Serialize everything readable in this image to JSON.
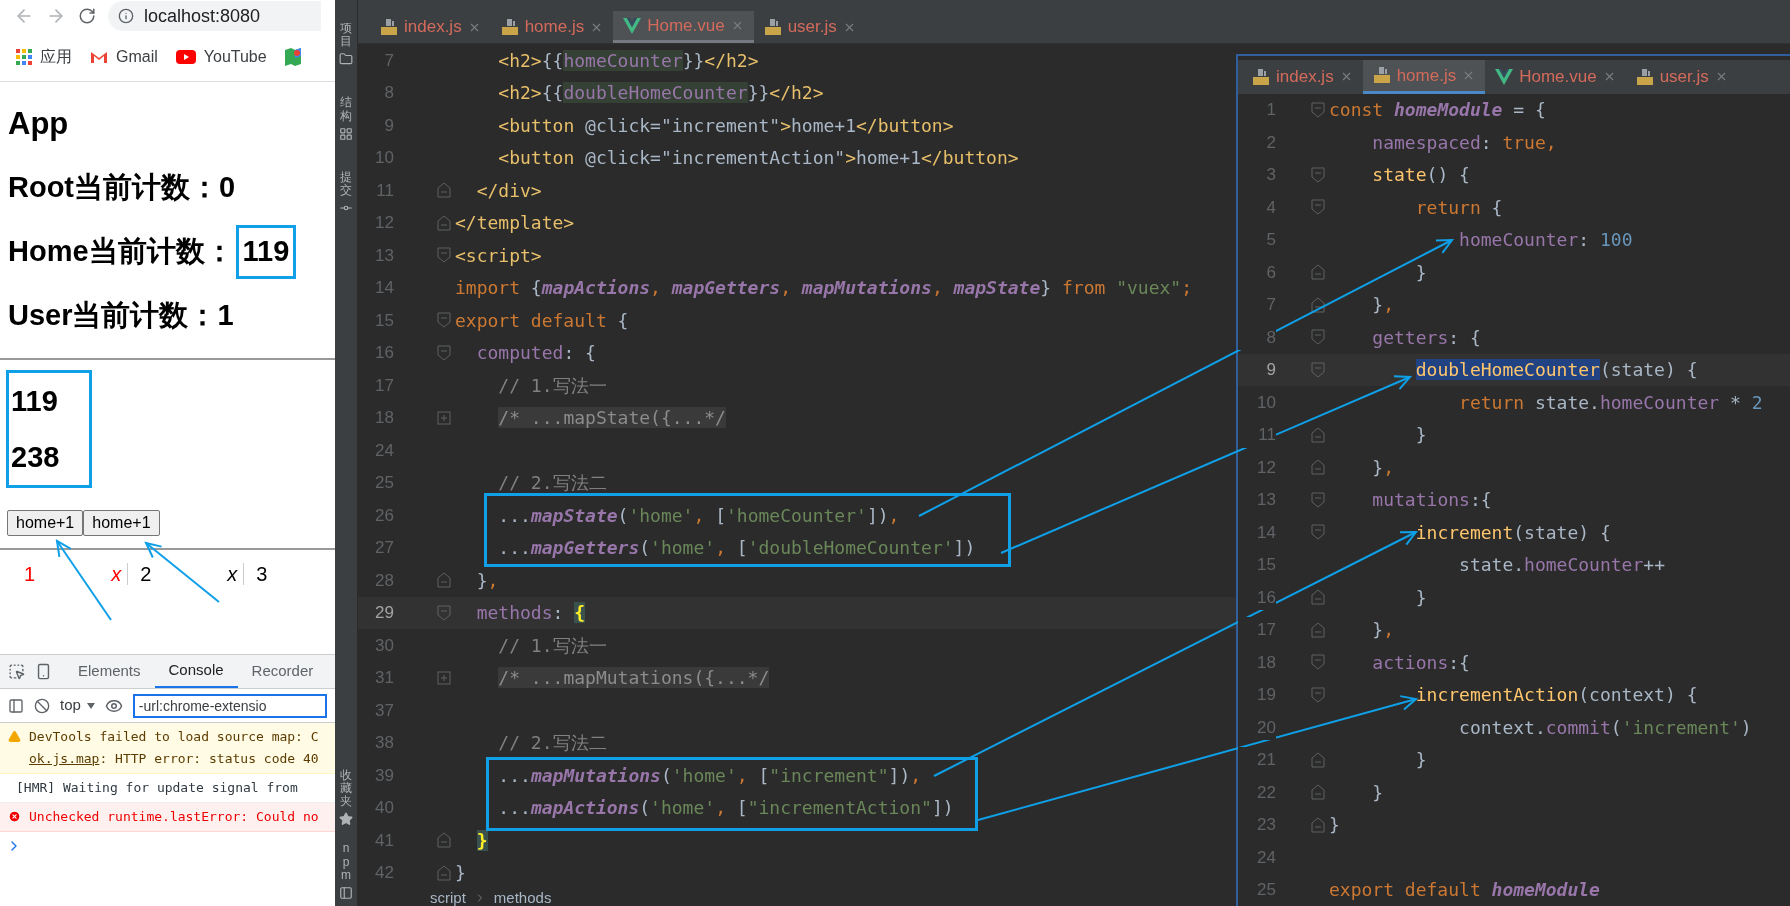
{
  "browser": {
    "url": "localhost:8080",
    "bookmarks": [
      {
        "kind": "apps",
        "label": "应用"
      },
      {
        "kind": "gmail",
        "label": "Gmail"
      },
      {
        "kind": "youtube",
        "label": "YouTube"
      },
      {
        "kind": "maps"
      }
    ],
    "page": {
      "title": "App",
      "counters": [
        {
          "label": "Root当前计数：",
          "value": "0",
          "highlighted": false
        },
        {
          "label": "Home当前计数：",
          "value": "119",
          "highlighted": true
        },
        {
          "label": "User当前计数：",
          "value": "1",
          "highlighted": false
        }
      ],
      "values": [
        "119",
        "238"
      ],
      "buttons": [
        "home+1",
        "home+1"
      ],
      "results": [
        {
          "text": "1",
          "invalid": true,
          "italic": false,
          "divider": false
        },
        {
          "text": "x",
          "invalid": true,
          "italic": true,
          "divider": true
        },
        {
          "text": "2",
          "invalid": false,
          "italic": false,
          "divider": false
        },
        {
          "text": "x",
          "invalid": false,
          "italic": true,
          "divider": true
        },
        {
          "text": "3",
          "invalid": false,
          "italic": false,
          "divider": false
        }
      ]
    },
    "devtools": {
      "tabs": [
        {
          "label": "Elements",
          "selected": false
        },
        {
          "label": "Console",
          "selected": true
        },
        {
          "label": "Recorder",
          "selected": false
        }
      ],
      "context": "top",
      "filter": "-url:chrome-extensio",
      "messages": [
        {
          "kind": "warning",
          "text": "DevTools failed to load source map: C",
          "link": "ok.js.map",
          "detail": ": HTTP error: status code 40"
        },
        {
          "kind": "info",
          "text": "[HMR] Waiting for update signal from"
        },
        {
          "kind": "error",
          "text": "Unchecked runtime.lastError: Could no"
        }
      ]
    }
  },
  "tool_strip": {
    "top": [
      {
        "kind": "project",
        "label": "项目"
      },
      {
        "kind": "structure",
        "label": "结构"
      },
      {
        "kind": "commit",
        "label": "提交"
      }
    ],
    "bottom": [
      {
        "kind": "favorites",
        "label": "收藏夹"
      },
      {
        "kind": "npm",
        "label": "npm"
      }
    ]
  },
  "editor": {
    "tabs": [
      {
        "label": "index.js",
        "kind": "js",
        "selected": false
      },
      {
        "label": "home.js",
        "kind": "js",
        "selected": false
      },
      {
        "label": "Home.vue",
        "kind": "vue",
        "selected": true
      },
      {
        "label": "user.js",
        "kind": "js",
        "selected": false
      }
    ],
    "lines": [
      {
        "number": "7",
        "current": false,
        "tokens": [
          {
            "text": "    <h2>",
            "kind": "tag"
          },
          {
            "text": "{{",
            "kind": "plain"
          },
          {
            "text": "homeCounter",
            "kind": "usage"
          },
          {
            "text": "}}",
            "kind": "plain"
          },
          {
            "text": "</h2>",
            "kind": "tag"
          }
        ]
      },
      {
        "number": "8",
        "current": false,
        "tokens": [
          {
            "text": "    <h2>",
            "kind": "tag"
          },
          {
            "text": "{{",
            "kind": "plain"
          },
          {
            "text": "doubleHomeCounter",
            "kind": "usage"
          },
          {
            "text": "}}",
            "kind": "plain"
          },
          {
            "text": "</h2>",
            "kind": "tag"
          }
        ]
      },
      {
        "number": "9",
        "current": false,
        "tokens": [
          {
            "text": "    <button ",
            "kind": "tag"
          },
          {
            "text": "@click=\"increment\"",
            "kind": "plain"
          },
          {
            "text": ">",
            "kind": "tag"
          },
          {
            "text": "home+1",
            "kind": "plain"
          },
          {
            "text": "</button>",
            "kind": "tag"
          }
        ]
      },
      {
        "number": "10",
        "current": false,
        "tokens": [
          {
            "text": "    <button ",
            "kind": "tag"
          },
          {
            "text": "@click=\"incrementAction\"",
            "kind": "plain"
          },
          {
            "text": ">",
            "kind": "tag"
          },
          {
            "text": "home+1",
            "kind": "plain"
          },
          {
            "text": "</button>",
            "kind": "tag"
          }
        ]
      },
      {
        "number": "11",
        "current": false,
        "kind": "close",
        "tokens": [
          {
            "text": "  </div>",
            "kind": "tag"
          }
        ]
      },
      {
        "number": "12",
        "current": false,
        "kind": "close",
        "tokens": [
          {
            "text": "</template>",
            "kind": "tag"
          }
        ]
      },
      {
        "number": "13",
        "current": false,
        "kind": "open",
        "tokens": [
          {
            "text": "<script>",
            "kind": "tag"
          }
        ]
      },
      {
        "number": "14",
        "current": false,
        "tokens": [
          {
            "text": "import ",
            "kind": "keyword"
          },
          {
            "text": "{",
            "kind": "plain"
          },
          {
            "text": "mapActions",
            "kind": "func"
          },
          {
            "text": ", ",
            "kind": "keyword"
          },
          {
            "text": "mapGetters",
            "kind": "func"
          },
          {
            "text": ", ",
            "kind": "keyword"
          },
          {
            "text": "mapMutations",
            "kind": "func"
          },
          {
            "text": ", ",
            "kind": "keyword"
          },
          {
            "text": "mapState",
            "kind": "func"
          },
          {
            "text": "} ",
            "kind": "plain"
          },
          {
            "text": "from ",
            "kind": "keyword"
          },
          {
            "text": "\"vuex\"",
            "kind": "string"
          },
          {
            "text": ";",
            "kind": "keyword"
          }
        ]
      },
      {
        "number": "15",
        "current": false,
        "kind": "open",
        "tokens": [
          {
            "text": "export default ",
            "kind": "keyword"
          },
          {
            "text": "{",
            "kind": "plain"
          }
        ]
      },
      {
        "number": "16",
        "current": false,
        "kind": "open",
        "tokens": [
          {
            "text": "  computed",
            "kind": "prop"
          },
          {
            "text": ": {",
            "kind": "plain"
          }
        ]
      },
      {
        "number": "17",
        "current": false,
        "tokens": [
          {
            "text": "    // 1.写法一",
            "kind": "comment"
          }
        ]
      },
      {
        "number": "18",
        "current": false,
        "kind": "collapsed",
        "tokens": [
          {
            "text": "    /* ...mapState({...*/",
            "kind": "folded"
          }
        ]
      },
      {
        "number": "24",
        "current": false
      },
      {
        "number": "25",
        "current": false,
        "tokens": [
          {
            "text": "    // 2.写法二",
            "kind": "comment"
          }
        ]
      },
      {
        "number": "26",
        "current": false,
        "tokens": [
          {
            "text": "    ...",
            "kind": "plain"
          },
          {
            "text": "mapState",
            "kind": "func"
          },
          {
            "text": "(",
            "kind": "plain"
          },
          {
            "text": "'home'",
            "kind": "string"
          },
          {
            "text": ", ",
            "kind": "keyword"
          },
          {
            "text": "[",
            "kind": "plain"
          },
          {
            "text": "'homeCounter'",
            "kind": "string"
          },
          {
            "text": "])",
            "kind": "plain"
          },
          {
            "text": ",",
            "kind": "keyword"
          }
        ]
      },
      {
        "number": "27",
        "current": false,
        "tokens": [
          {
            "text": "    ...",
            "kind": "plain"
          },
          {
            "text": "mapGetters",
            "kind": "func"
          },
          {
            "text": "(",
            "kind": "plain"
          },
          {
            "text": "'home'",
            "kind": "string"
          },
          {
            "text": ", ",
            "kind": "keyword"
          },
          {
            "text": "[",
            "kind": "plain"
          },
          {
            "text": "'doubleHomeCounter'",
            "kind": "string"
          },
          {
            "text": "])",
            "kind": "plain"
          }
        ]
      },
      {
        "number": "28",
        "current": false,
        "kind": "close",
        "tokens": [
          {
            "text": "  }",
            "kind": "plain"
          },
          {
            "text": ",",
            "kind": "keyword"
          }
        ]
      },
      {
        "number": "29",
        "current": true,
        "kind": "open",
        "tokens": [
          {
            "text": "  methods",
            "kind": "prop"
          },
          {
            "text": ": ",
            "kind": "plain"
          },
          {
            "text": "{",
            "kind": "brace"
          }
        ]
      },
      {
        "number": "30",
        "current": false,
        "tokens": [
          {
            "text": "    // 1.写法一",
            "kind": "comment"
          }
        ]
      },
      {
        "number": "31",
        "current": false,
        "kind": "collapsed",
        "tokens": [
          {
            "text": "    /* ...mapMutations({...*/",
            "kind": "folded"
          }
        ]
      },
      {
        "number": "37",
        "current": false
      },
      {
        "number": "38",
        "current": false,
        "tokens": [
          {
            "text": "    // 2.写法二",
            "kind": "comment"
          }
        ]
      },
      {
        "number": "39",
        "current": false,
        "tokens": [
          {
            "text": "    ...",
            "kind": "plain"
          },
          {
            "text": "mapMutations",
            "kind": "func"
          },
          {
            "text": "(",
            "kind": "plain"
          },
          {
            "text": "'home'",
            "kind": "string"
          },
          {
            "text": ", ",
            "kind": "keyword"
          },
          {
            "text": "[",
            "kind": "plain"
          },
          {
            "text": "\"increment\"",
            "kind": "string"
          },
          {
            "text": "])",
            "kind": "plain"
          },
          {
            "text": ",",
            "kind": "keyword"
          }
        ]
      },
      {
        "number": "40",
        "current": false,
        "tokens": [
          {
            "text": "    ...",
            "kind": "plain"
          },
          {
            "text": "mapActions",
            "kind": "func"
          },
          {
            "text": "(",
            "kind": "plain"
          },
          {
            "text": "'home'",
            "kind": "string"
          },
          {
            "text": ", ",
            "kind": "keyword"
          },
          {
            "text": "[",
            "kind": "plain"
          },
          {
            "text": "\"incrementAction\"",
            "kind": "string"
          },
          {
            "text": "])",
            "kind": "plain"
          }
        ]
      },
      {
        "number": "41",
        "current": false,
        "kind": "close",
        "tokens": [
          {
            "text": "  }",
            "kind": "brace"
          }
        ]
      },
      {
        "number": "42",
        "current": false,
        "kind": "close",
        "tokens": [
          {
            "text": "}",
            "kind": "plain"
          }
        ]
      }
    ],
    "breadcrumb": [
      "script",
      "methods"
    ]
  },
  "split_editor": {
    "tabs": [
      {
        "label": "index.js",
        "kind": "js",
        "selected": false
      },
      {
        "label": "home.js",
        "kind": "js",
        "selected": true
      },
      {
        "label": "Home.vue",
        "kind": "vue",
        "selected": false
      },
      {
        "label": "user.js",
        "kind": "js",
        "selected": false
      }
    ],
    "lines": [
      {
        "number": "1",
        "current": false,
        "kind": "open",
        "tokens": [
          {
            "text": "const ",
            "kind": "keyword"
          },
          {
            "text": "homeModule",
            "kind": "func"
          },
          {
            "text": " = {",
            "kind": "plain"
          }
        ]
      },
      {
        "number": "2",
        "current": false,
        "tokens": [
          {
            "text": "    namespaced",
            "kind": "prop"
          },
          {
            "text": ": ",
            "kind": "plain"
          },
          {
            "text": "true",
            "kind": "keyword"
          },
          {
            "text": ",",
            "kind": "keyword"
          }
        ]
      },
      {
        "number": "3",
        "current": false,
        "kind": "open",
        "tokens": [
          {
            "text": "    state",
            "kind": "call"
          },
          {
            "text": "() {",
            "kind": "plain"
          }
        ]
      },
      {
        "number": "4",
        "current": false,
        "kind": "open",
        "tokens": [
          {
            "text": "        return ",
            "kind": "keyword"
          },
          {
            "text": "{",
            "kind": "plain"
          }
        ]
      },
      {
        "number": "5",
        "current": false,
        "tokens": [
          {
            "text": "            homeCounter",
            "kind": "prop"
          },
          {
            "text": ": ",
            "kind": "plain"
          },
          {
            "text": "100",
            "kind": "number"
          }
        ]
      },
      {
        "number": "6",
        "current": false,
        "kind": "close",
        "tokens": [
          {
            "text": "        }",
            "kind": "plain"
          }
        ]
      },
      {
        "number": "7",
        "current": false,
        "kind": "close",
        "tokens": [
          {
            "text": "    }",
            "kind": "plain"
          },
          {
            "text": ",",
            "kind": "keyword"
          }
        ]
      },
      {
        "number": "8",
        "current": false,
        "kind": "open",
        "tokens": [
          {
            "text": "    getters",
            "kind": "prop"
          },
          {
            "text": ": {",
            "kind": "plain"
          }
        ]
      },
      {
        "number": "9",
        "current": true,
        "kind": "open",
        "tokens": [
          {
            "text": "        doubleHomeCounter",
            "kind": "selection"
          },
          {
            "text": "(state) {",
            "kind": "plain"
          }
        ]
      },
      {
        "number": "10",
        "current": false,
        "tokens": [
          {
            "text": "            return ",
            "kind": "keyword"
          },
          {
            "text": "state.",
            "kind": "plain"
          },
          {
            "text": "homeCounter",
            "kind": "prop"
          },
          {
            "text": " * ",
            "kind": "plain"
          },
          {
            "text": "2",
            "kind": "number"
          }
        ]
      },
      {
        "number": "11",
        "current": false,
        "kind": "close",
        "tokens": [
          {
            "text": "        }",
            "kind": "plain"
          }
        ]
      },
      {
        "number": "12",
        "current": false,
        "kind": "close",
        "tokens": [
          {
            "text": "    }",
            "kind": "plain"
          },
          {
            "text": ",",
            "kind": "keyword"
          }
        ]
      },
      {
        "number": "13",
        "current": false,
        "kind": "open",
        "tokens": [
          {
            "text": "    mutations",
            "kind": "prop"
          },
          {
            "text": ":{",
            "kind": "plain"
          }
        ]
      },
      {
        "number": "14",
        "current": false,
        "kind": "open",
        "tokens": [
          {
            "text": "        increment",
            "kind": "call"
          },
          {
            "text": "(state) {",
            "kind": "plain"
          }
        ]
      },
      {
        "number": "15",
        "current": false,
        "tokens": [
          {
            "text": "            state.",
            "kind": "plain"
          },
          {
            "text": "homeCounter",
            "kind": "prop"
          },
          {
            "text": "++",
            "kind": "plain"
          }
        ]
      },
      {
        "number": "16",
        "current": false,
        "kind": "close",
        "tokens": [
          {
            "text": "        }",
            "kind": "plain"
          }
        ]
      },
      {
        "number": "17",
        "current": false,
        "kind": "close",
        "tokens": [
          {
            "text": "    }",
            "kind": "plain"
          },
          {
            "text": ",",
            "kind": "keyword"
          }
        ]
      },
      {
        "number": "18",
        "current": false,
        "kind": "open",
        "tokens": [
          {
            "text": "    actions",
            "kind": "prop"
          },
          {
            "text": ":{",
            "kind": "plain"
          }
        ]
      },
      {
        "number": "19",
        "current": false,
        "kind": "open",
        "tokens": [
          {
            "text": "        incrementAction",
            "kind": "call"
          },
          {
            "text": "(context) {",
            "kind": "plain"
          }
        ]
      },
      {
        "number": "20",
        "current": false,
        "tokens": [
          {
            "text": "            context.",
            "kind": "plain"
          },
          {
            "text": "commit",
            "kind": "prop"
          },
          {
            "text": "(",
            "kind": "plain"
          },
          {
            "text": "'increment'",
            "kind": "string"
          },
          {
            "text": ")",
            "kind": "plain"
          }
        ]
      },
      {
        "number": "21",
        "current": false,
        "kind": "close",
        "tokens": [
          {
            "text": "        }",
            "kind": "plain"
          }
        ]
      },
      {
        "number": "22",
        "current": false,
        "kind": "close",
        "tokens": [
          {
            "text": "    }",
            "kind": "plain"
          }
        ]
      },
      {
        "number": "23",
        "current": false,
        "kind": "close",
        "tokens": [
          {
            "text": "}",
            "kind": "plain"
          }
        ]
      },
      {
        "number": "24",
        "current": false
      },
      {
        "number": "25",
        "current": false,
        "tokens": [
          {
            "text": "export default ",
            "kind": "keyword"
          },
          {
            "text": "homeModule",
            "kind": "func"
          }
        ]
      }
    ]
  }
}
